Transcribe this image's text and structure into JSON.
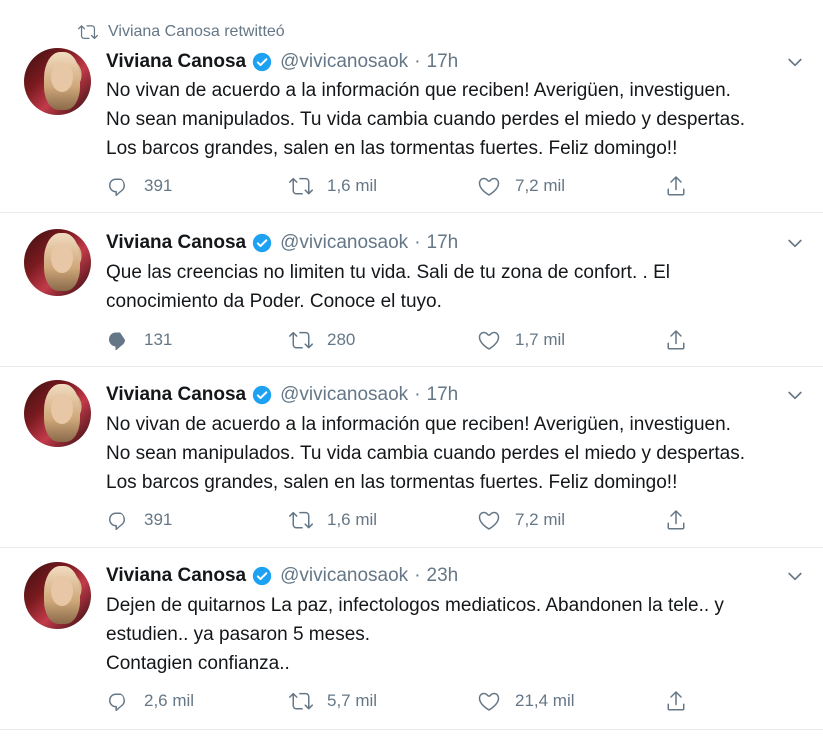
{
  "retweet_note": "Viviana Canosa retwitteó",
  "colors": {
    "accent": "#1da1f2",
    "muted": "#657786",
    "text": "#14171a",
    "divider": "#e6ecf0"
  },
  "icons": {
    "retweet": "retweet-icon",
    "verified": "verified-badge-icon",
    "caret": "chevron-down-icon",
    "reply": "reply-icon",
    "like": "heart-icon",
    "share": "share-icon"
  },
  "tweets": [
    {
      "name": "Viviana Canosa",
      "handle": "@vivicanosaok",
      "separator": "·",
      "time": "17h",
      "lines": [
        "No vivan de acuerdo a la información que reciben! Averigüen, investiguen.",
        "No sean manipulados. Tu vida cambia cuando perdes el miedo y despertas.",
        "Los barcos grandes, salen en las tormentas fuertes. Feliz domingo!!"
      ],
      "replies": "391",
      "retweets": "1,6 mil",
      "likes": "7,2 mil"
    },
    {
      "name": "Viviana Canosa",
      "handle": "@vivicanosaok",
      "separator": "·",
      "time": "17h",
      "lines": [
        "Que las creencias no limiten tu vida. Sali de tu zona de confort. . El",
        "conocimiento da Poder. Conoce el tuyo."
      ],
      "replies": "131",
      "retweets": "280",
      "likes": "1,7 mil"
    },
    {
      "name": "Viviana Canosa",
      "handle": "@vivicanosaok",
      "separator": "·",
      "time": "17h",
      "lines": [
        "No vivan de acuerdo a la información que reciben! Averigüen, investiguen.",
        "No sean manipulados. Tu vida cambia cuando perdes el miedo y despertas.",
        "Los barcos grandes, salen en las tormentas fuertes. Feliz domingo!!"
      ],
      "replies": "391",
      "retweets": "1,6 mil",
      "likes": "7,2 mil"
    },
    {
      "name": "Viviana Canosa",
      "handle": "@vivicanosaok",
      "separator": "·",
      "time": "23h",
      "lines": [
        "Dejen de quitarnos La paz, infectologos mediaticos. Abandonen la tele.. y",
        "estudien.. ya pasaron 5 meses.",
        "Contagien confianza.."
      ],
      "replies": "2,6 mil",
      "retweets": "5,7 mil",
      "likes": "21,4 mil"
    }
  ]
}
